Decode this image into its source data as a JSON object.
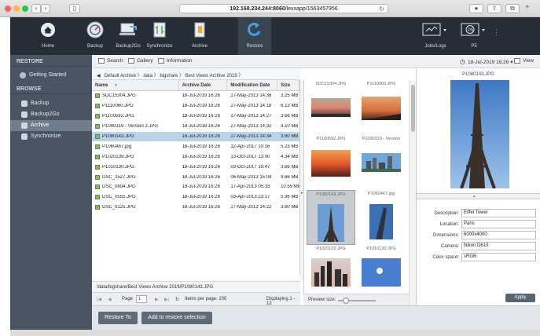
{
  "browser": {
    "url_host": "192.168.234.244:8060",
    "url_path": "/lexxapp/1563457956"
  },
  "toolbar": {
    "items": [
      {
        "label": "Home",
        "icon": "home-icon"
      },
      {
        "label": "Backup",
        "icon": "backup-dial-icon"
      },
      {
        "label": "Backup2Go",
        "icon": "backup2go-icon"
      },
      {
        "label": "Synchronize",
        "icon": "sync-icon"
      },
      {
        "label": "Archive",
        "icon": "archive-icon"
      },
      {
        "label": "Restore",
        "icon": "restore-arrow-icon"
      }
    ],
    "right_items": [
      {
        "label": "Jobs/Logs",
        "icon": "monitor-icon"
      },
      {
        "label": "P5",
        "icon": "p5-icon"
      }
    ]
  },
  "sidebar": {
    "restore_header": "RESTORE",
    "restore_items": [
      {
        "label": "Getting Started"
      }
    ],
    "browse_header": "BROWSE",
    "browse_items": [
      {
        "label": "Backup"
      },
      {
        "label": "Backup2Go"
      },
      {
        "label": "Archive"
      },
      {
        "label": "Synchronize"
      }
    ]
  },
  "tabs": {
    "search": "Search",
    "gallery": "Gallery",
    "information": "Information",
    "date": "18-Jul-2019 16:26 ▾",
    "view": "View"
  },
  "breadcrumb": {
    "items": [
      "Default Archive",
      "data",
      "bigshare",
      "Best Views Archive 2019"
    ]
  },
  "table": {
    "headers": [
      "Name",
      "Archive Date",
      "Modification Date",
      "Size"
    ],
    "rows": [
      [
        "SDC15304.JPG",
        "18-Jul-2019 16:26",
        "27-May-2013 14:36",
        "3.25 MB"
      ],
      [
        "P1110060.JPG",
        "18-Jul-2019 16:26",
        "27-May-2013 14:18",
        "6.13 MB"
      ],
      [
        "P1100592.JPG",
        "18-Jul-2019 16:26",
        "27-May-2013 14:27",
        "3.66 MB"
      ],
      [
        "P1090319 - Version 2.JPG",
        "18-Jul-2019 16:26",
        "27-May-2013 14:32",
        "4.10 MB"
      ],
      [
        "P1080143.JPG",
        "18-Jul-2019 16:26",
        "27-May-2013 14:34",
        "3.60 MB"
      ],
      [
        "P1060467.jpg",
        "18-Jul-2019 16:26",
        "12-Apr-2017 10:16",
        "5.23 MB"
      ],
      [
        "P1020139.JPG",
        "18-Jul-2019 16:26",
        "13-Oct-2017 13:00",
        "4.34 MB"
      ],
      [
        "P1010130.JPG",
        "18-Jul-2019 16:26",
        "03-Oct-2017 19:47",
        "3.66 MB"
      ],
      [
        "DSC_2527.JPG",
        "18-Jul-2019 16:26",
        "06-May-2013 15:04",
        "9.66 MB"
      ],
      [
        "DSC_0804.JPG",
        "18-Jul-2019 16:26",
        "17-Apr-2013 05:33",
        "10.59 MB"
      ],
      [
        "DSC_0555.JPG",
        "18-Jul-2019 16:26",
        "03-Apr-2013 23:17",
        "5.96 MB"
      ],
      [
        "DSC_0125.JPG",
        "18-Jul-2019 16:26",
        "27-May-2013 14:22",
        "3.80 MB"
      ]
    ],
    "selected_index": 4
  },
  "path": "/data/bigshare/Best Views Archive 2019/P1080143.JPG",
  "pager": {
    "page_label": "Page",
    "page_value": "1",
    "items_per_page": "Items per page: 200",
    "displaying": "Displaying 1 - 12"
  },
  "thumbnails": [
    {
      "caption": "SDC15304.JPG"
    },
    {
      "caption": "P1110060.JPG"
    },
    {
      "caption": "P1100592.JPG"
    },
    {
      "caption": "P1090319 - Version"
    },
    {
      "caption": "P1080143.JPG"
    },
    {
      "caption": "P1060467.jpg"
    },
    {
      "caption": "P1020139.JPG"
    },
    {
      "caption": "P1010130.JPG"
    }
  ],
  "preview_size_label": "Preview size:",
  "preview": {
    "title": "P1080143.JPG",
    "properties": [
      {
        "label": "Description:",
        "value": "Eiffel Tower"
      },
      {
        "label": "Location:",
        "value": "Paris"
      },
      {
        "label": "Dimensions:",
        "value": "6000x4000"
      },
      {
        "label": "Camera:",
        "value": "Nikon D610"
      },
      {
        "label": "Color space:",
        "value": "sRGB"
      }
    ],
    "apply": "Apply"
  },
  "footer": {
    "restore_to": "Restore To",
    "add_selection": "Add to restore selection"
  }
}
